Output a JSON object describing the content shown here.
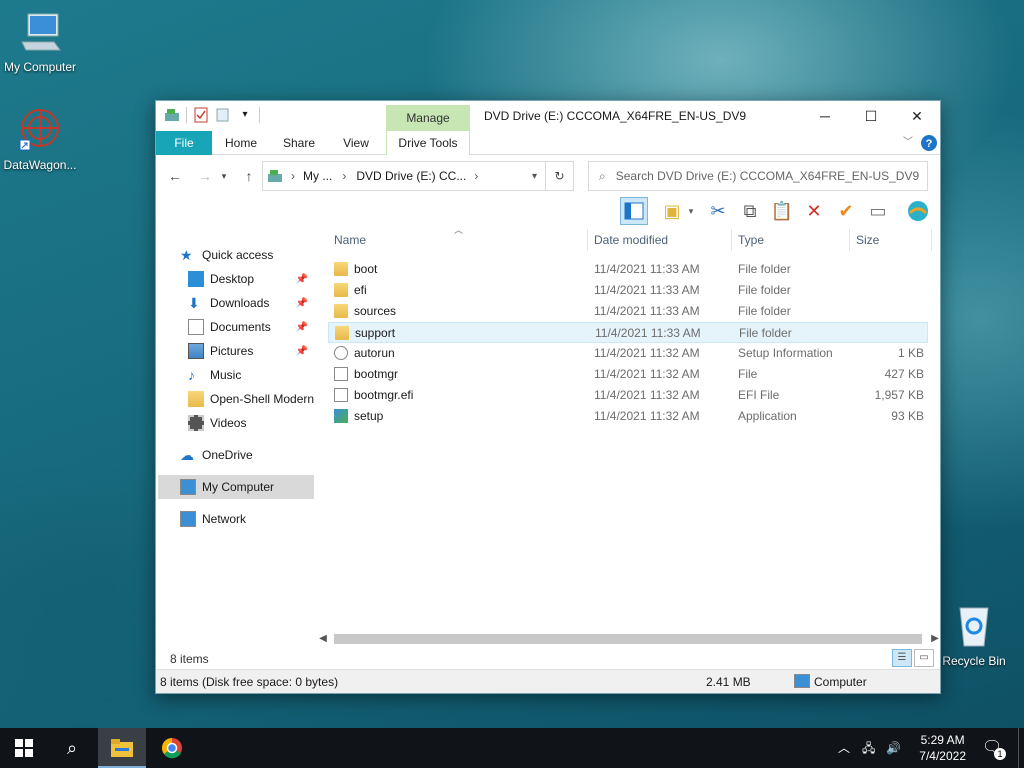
{
  "desktop": {
    "icons": [
      {
        "label": "My Computer"
      },
      {
        "label": "DataWagon..."
      },
      {
        "label": "Recycle Bin"
      }
    ]
  },
  "window": {
    "manage_label": "Manage",
    "title": "DVD Drive (E:) CCCOMA_X64FRE_EN-US_DV9",
    "tabs": {
      "file": "File",
      "home": "Home",
      "share": "Share",
      "view": "View",
      "drive_tools": "Drive Tools"
    },
    "address": {
      "seg1": "My ...",
      "seg2": "DVD Drive (E:) CC..."
    },
    "search_placeholder": "Search DVD Drive (E:) CCCOMA_X64FRE_EN-US_DV9"
  },
  "nav": {
    "quick_access": "Quick access",
    "desktop": "Desktop",
    "downloads": "Downloads",
    "documents": "Documents",
    "pictures": "Pictures",
    "music": "Music",
    "openshell": "Open-Shell Modern",
    "videos": "Videos",
    "onedrive": "OneDrive",
    "mycomputer": "My Computer",
    "network": "Network"
  },
  "columns": {
    "name": "Name",
    "date": "Date modified",
    "type": "Type",
    "size": "Size"
  },
  "files": [
    {
      "name": "boot",
      "date": "11/4/2021 11:33 AM",
      "type": "File folder",
      "size": ""
    },
    {
      "name": "efi",
      "date": "11/4/2021 11:33 AM",
      "type": "File folder",
      "size": ""
    },
    {
      "name": "sources",
      "date": "11/4/2021 11:33 AM",
      "type": "File folder",
      "size": ""
    },
    {
      "name": "support",
      "date": "11/4/2021 11:33 AM",
      "type": "File folder",
      "size": ""
    },
    {
      "name": "autorun",
      "date": "11/4/2021 11:32 AM",
      "type": "Setup Information",
      "size": "1 KB"
    },
    {
      "name": "bootmgr",
      "date": "11/4/2021 11:32 AM",
      "type": "File",
      "size": "427 KB"
    },
    {
      "name": "bootmgr.efi",
      "date": "11/4/2021 11:32 AM",
      "type": "EFI File",
      "size": "1,957 KB"
    },
    {
      "name": "setup",
      "date": "11/4/2021 11:32 AM",
      "type": "Application",
      "size": "93 KB"
    }
  ],
  "footer": {
    "item_count": "8 items",
    "status_left": "8 items (Disk free space: 0 bytes)",
    "status_size": "2.41 MB",
    "status_location": "Computer"
  },
  "taskbar": {
    "time": "5:29 AM",
    "date": "7/4/2022",
    "notification_count": "1"
  }
}
